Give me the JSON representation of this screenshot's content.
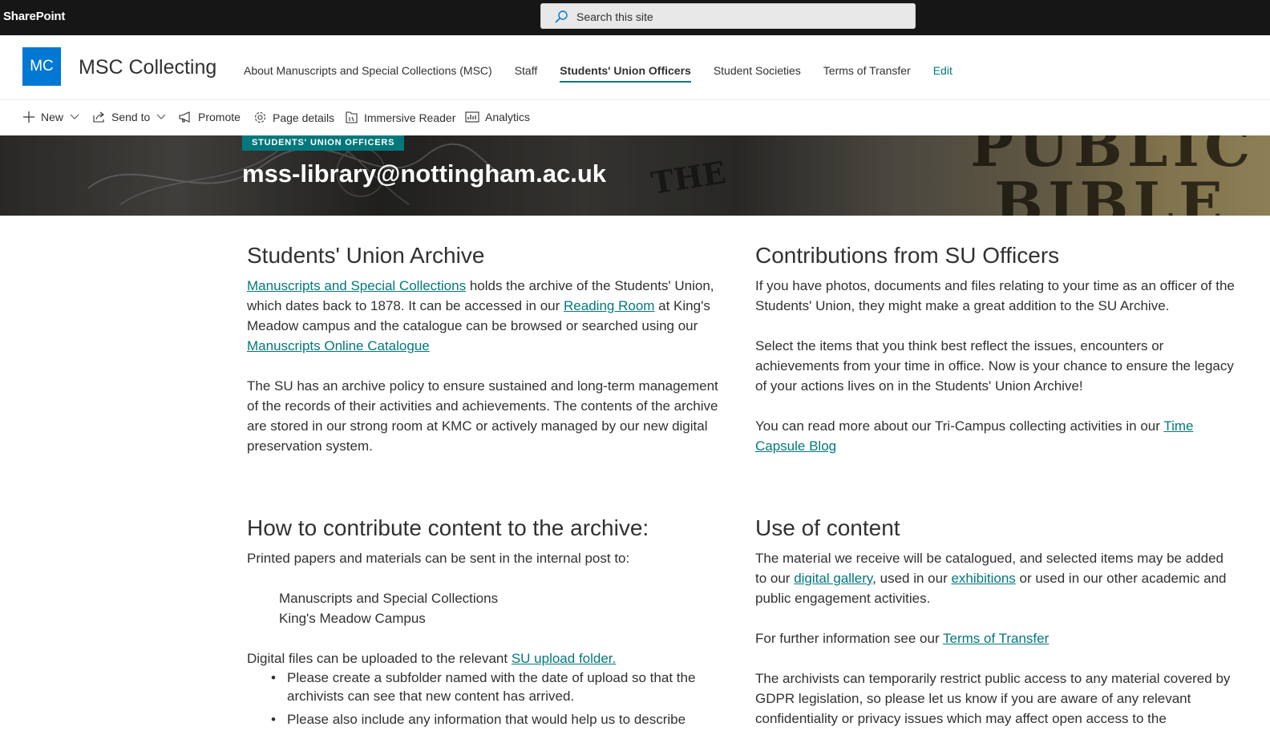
{
  "suitebar": {
    "brand": "SharePoint",
    "search_placeholder": "Search this site"
  },
  "site": {
    "logo_initials": "MC",
    "title": "MSC Collecting",
    "logo_color": "#0078d4",
    "accent_color": "#03787c"
  },
  "nav": {
    "items": [
      {
        "label": "About Manuscripts and Special Collections (MSC)"
      },
      {
        "label": "Staff"
      },
      {
        "label": "Students' Union Officers"
      },
      {
        "label": "Student Societies"
      },
      {
        "label": "Terms of Transfer"
      }
    ],
    "edit_label": "Edit",
    "active_item": "Students' Union Officers"
  },
  "commands": {
    "new": "New",
    "send_to": "Send to",
    "promote": "Promote",
    "page_details": "Page details",
    "immersive_reader": "Immersive Reader",
    "analytics": "Analytics"
  },
  "hero": {
    "tag": "STUDENTS' UNION OFFICERS",
    "title": "mss-library@nottingham.ac.uk",
    "deco_text_1": "THE",
    "deco_text_2": "PUBLIC",
    "deco_text_3": "BIBLE"
  },
  "left_top": {
    "heading": "Students' Union Archive",
    "p1_link1": "Manuscripts and Special Collections",
    "p1_text1": " holds the archive of the Students' Union, which dates back to 1878. It can be accessed in our ",
    "p1_link2": "Reading Room",
    "p1_text2": " at King's Meadow campus and the catalogue can be browsed or searched using our ",
    "p1_link3": "Manuscripts Online Catalogue",
    "p2": "The SU has an archive policy to ensure sustained and long-term management of the records of their activities and achievements. The contents of the archive are stored in our strong room at KMC or actively managed by our new digital preservation system."
  },
  "right_top": {
    "heading": "Contributions from SU Officers",
    "p1": "If you have photos, documents and files relating to your time as an officer of the Students' Union, they might make a great addition to the SU Archive.",
    "p2": "Select the items that you think best reflect the issues, encounters or achievements from your time in office. Now is your chance to ensure the legacy of your actions lives on in the Students' Union Archive!",
    "p3_text": "You can read more about our Tri-Campus collecting activities in our ",
    "p3_link": "Time Capsule Blog"
  },
  "left_bottom": {
    "heading": "How to contribute content to the archive:",
    "p1": "Printed papers and materials can be sent in the internal post to:",
    "address_line1": "Manuscripts and Special Collections",
    "address_line2": "King's Meadow Campus",
    "p2_text": "Digital files can be uploaded to the relevant ",
    "p2_link": "SU upload folder.",
    "bullets": [
      "Please create a subfolder named with the date of upload so that the archivists can see that new content has arrived.",
      "Please also include any information that would help us to describe"
    ]
  },
  "right_bottom": {
    "heading": "Use of content",
    "p1_text1": "The material we receive will be catalogued, and selected items may be added to our ",
    "p1_link1": "digital gallery",
    "p1_text2": ", used in our ",
    "p1_link2": "exhibitions",
    "p1_text3": " or used in our other academic and public engagement activities.",
    "p2_text": "For further information see our ",
    "p2_link": "Terms of Transfer",
    "p3": "The archivists can temporarily restrict public access to any material covered by GDPR legislation, so please let us know if you are aware of any relevant confidentiality or privacy issues which may affect open access to the"
  }
}
